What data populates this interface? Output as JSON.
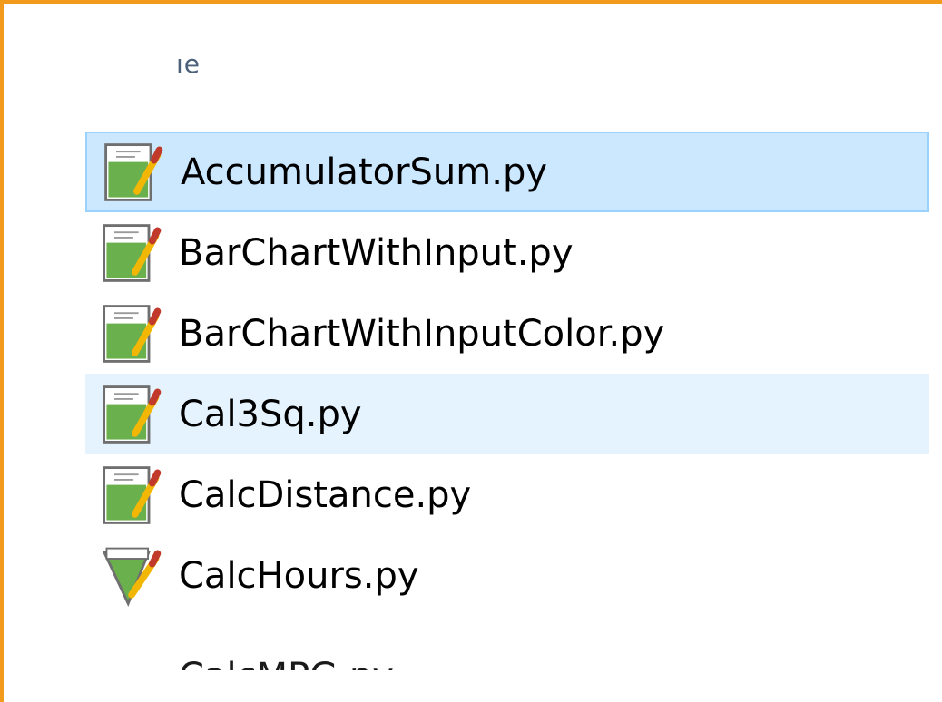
{
  "header": {
    "column_fragment": "ıe"
  },
  "files": [
    {
      "name": "AccumulatorSum.py",
      "state": "selected",
      "icon": "python-script-file-icon"
    },
    {
      "name": "BarChartWithInput.py",
      "state": "normal",
      "icon": "python-script-file-icon"
    },
    {
      "name": "BarChartWithInputColor.py",
      "state": "normal",
      "icon": "python-script-file-icon"
    },
    {
      "name": "Cal3Sq.py",
      "state": "hover",
      "icon": "python-script-file-icon"
    },
    {
      "name": "CalcDistance.py",
      "state": "normal",
      "icon": "python-script-file-icon"
    },
    {
      "name": "CalcHours.py",
      "state": "normal",
      "icon": "python-script-file-icon"
    },
    {
      "name": "CalcMPG.py",
      "state": "partially-visible",
      "icon": "python-script-file-icon"
    }
  ],
  "colors": {
    "window_border": "#f29a1c",
    "selected_bg": "#cce8ff",
    "selected_border": "#99d1ff",
    "hover_bg": "#e5f3ff"
  }
}
